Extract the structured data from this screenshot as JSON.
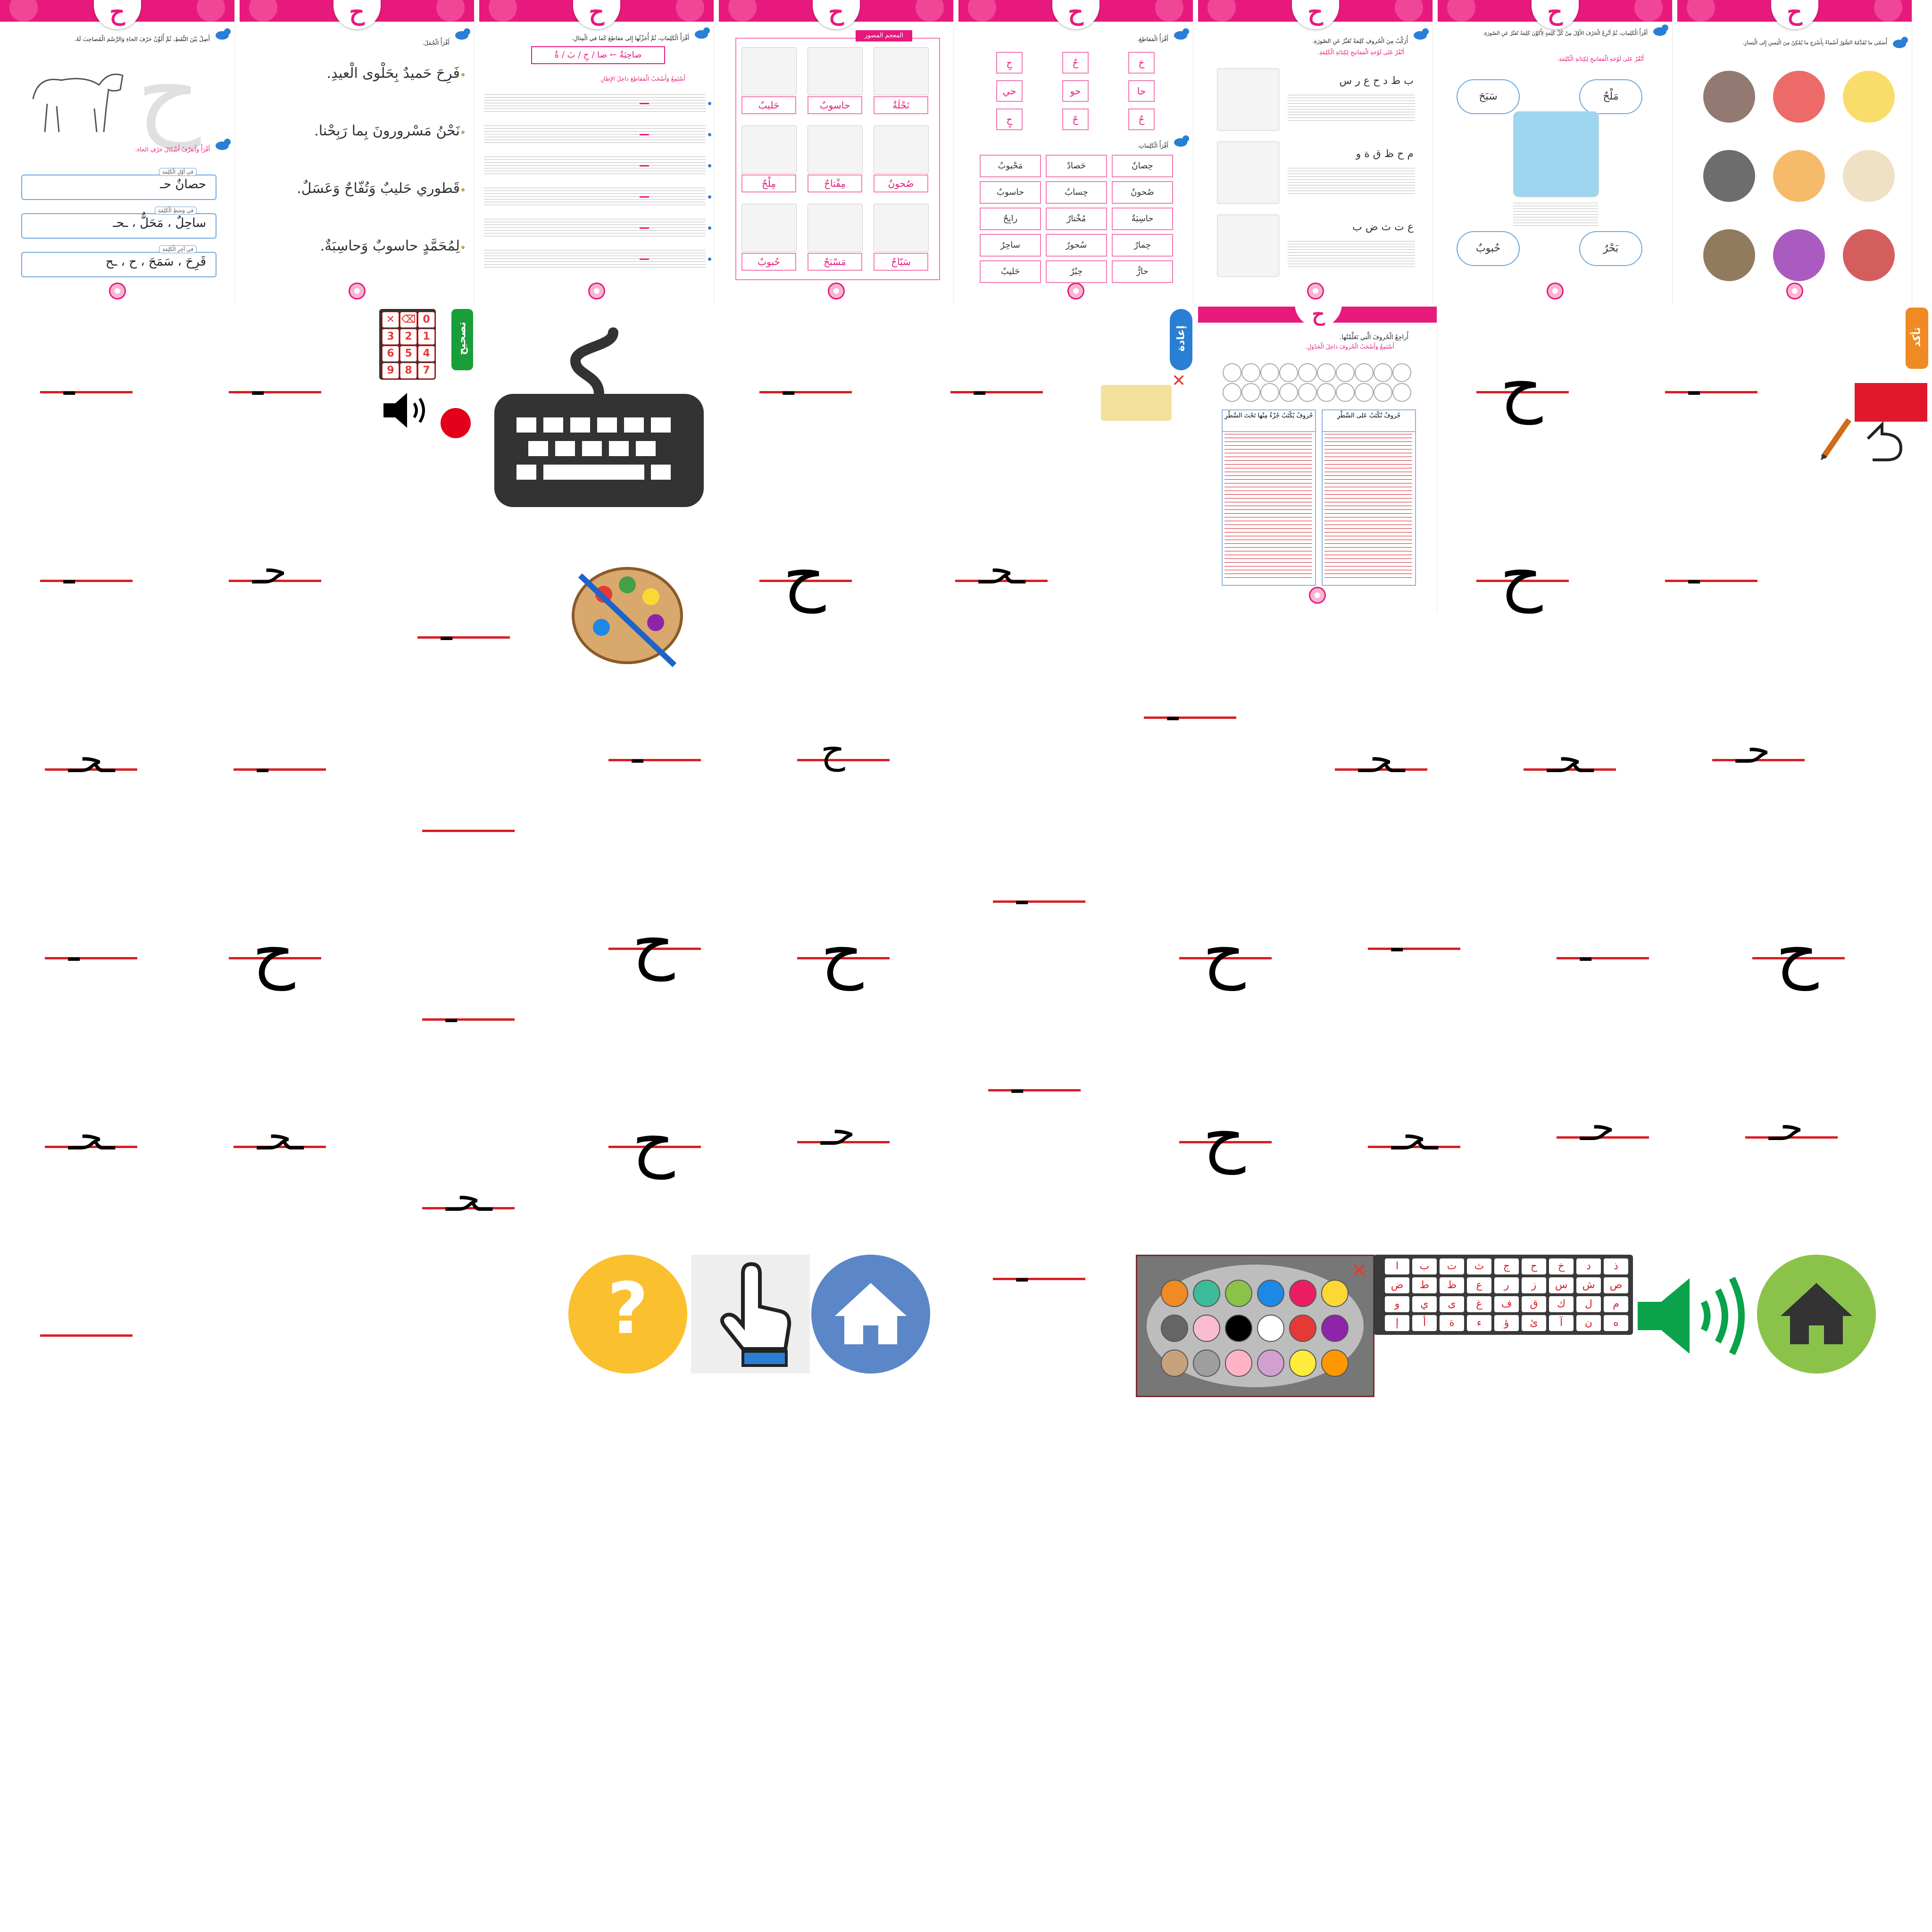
{
  "page_letter": "ح",
  "pages": [
    {
      "title": "ح",
      "inst1": "أَصِلُ بَيْنَ النُّقَطِ، ثُمَّ أُلَوِّنُ حَرْفَ الحاءِ وَالرَّسْمَ الْمُصاحِبَ لَهُ.",
      "inst2": "أَقْرَأُ وَأَتَعَرَّفُ أَشْكالَ حَرْفِ الحاءِ.",
      "rows": [
        {
          "label": "في أوَّلِ الْكَلِمَةِ",
          "text": "حصانٌ    حـ"
        },
        {
          "label": "في وَسَطِ الْكَلِمَةِ",
          "text": "ساحِلٌ ، مَحَلٌّ ، ـحـ"
        },
        {
          "label": "في آخِرِ الْكَلِمَةِ",
          "text": "قَرِحَ ، سَمَحَ ، ح ، ـح"
        }
      ]
    },
    {
      "title": "ح",
      "inst": "أَقْرَأُ الْجُمَلَ.",
      "sentences": [
        "فَرِحَ حَميدٌ بِحَلْوى الْعيدِ.",
        "نَحْنُ مَسْرورونَ بِما رَبِحْنا.",
        "قَطوري حَليبٌ وَتُفّاحٌ وَعَسَلٌ.",
        "لِمُحَمَّدٍ حاسوبٌ وَحاسِبَةٌ."
      ]
    },
    {
      "title": "ح",
      "inst": "أَقْرَأُ الْكَلِماتِ، ثُمَّ أُجَزِّئُها إِلى مَقاطِعَ كَما في الْمِثالِ.",
      "example": "صاحِبَةٌ ← صا / حِ / بَ / ةٌ",
      "sub": "أَسْتَمِعُ وَأَسْحَبُ الْمَقاطِعَ داخِلَ الإِطارِ."
    },
    {
      "title": "ح",
      "header": "المعجم المصور",
      "words": [
        "نَحْلَةٌ",
        "حاسوبٌ",
        "حَليبٌ",
        "صُحونٌ",
        "مِفْتاحٌ",
        "مِلْحٌ",
        "سَبّاحٌ",
        "مَسْبَحٌ",
        "حُبوبٌ"
      ]
    },
    {
      "title": "ح",
      "inst1": "أَقْرَأُ الْمَقاطِعَ.",
      "syllables": [
        "حَ",
        "حُ",
        "حِ",
        "حا",
        "حو",
        "حي",
        "حٌ",
        "حً",
        "حٍ"
      ],
      "inst2": "أَقْرَأُ الْكَلِماتِ.",
      "words": [
        "حِصانٌ",
        "حَصادٌ",
        "مَحْبوبٌ",
        "صُحونٌ",
        "حِسابٌ",
        "حاسوبٌ",
        "حاسِبَةٌ",
        "مُخْتارٌ",
        "رابِحٌ",
        "حِمارٌ",
        "سُحورٌ",
        "ساحِرٌ",
        "حارٌّ",
        "حِبْرٌ",
        "حَليبٌ"
      ]
    },
    {
      "title": "ح",
      "inst": "أُرَكِّبُ مِنَ الْحُروفِ كَلِمَةً تُعَبِّرُ عَنِ الصّورَةِ.",
      "sub": "أَنْقُرُ عَلى لَوْحَةِ الْمَفاتيحِ لِكِتابَةِ الْكَلِمَةِ.",
      "rows": [
        "ب ط د ح ع ر س",
        "م ح ظ ق ة و",
        "ع ت ث ض ب"
      ]
    },
    {
      "title": "ح",
      "inst": "أَقْرَأُ الْكَلِماتِ، ثُمَّ أَنْزِعُ الْحَرْفَ الأَوَّلَ مِنْ كُلِّ كَلِمَةٍ لِأُكَوِّنَ كَلِمَةً تُعَبِّرُ عَنِ الصّورَةِ.",
      "sub": "أَنْقُرُ عَلى لَوْحَةِ الْمَفاتيحِ لِكِتابَةِ الْكَلِمَةِ.",
      "clouds": [
        "مَلْحٌ",
        "سَبَحَ",
        "بَحْرٌ",
        "حُبوبٌ"
      ]
    },
    {
      "title": "ح",
      "inst": "أُسَمّي ما تُقَدِّمُهُ الصُّوَرُ أَسْماءً بِأَسْرَعِ ما يُمْكِنُ مِنَ الْيَمينِ إِلى الْيَسارِ."
    }
  ],
  "controls": {
    "correct_label": "تصحيح",
    "retry_label": "إعادة",
    "confirm_label": "تأكد",
    "keypad_keys": [
      "0",
      "⌫",
      "✕",
      "1",
      "2",
      "3",
      "4",
      "5",
      "6",
      "7",
      "8",
      "9"
    ],
    "review_inst": "أُراجِعُ الْحُروفَ الَّتي تَعَلَّمْتُها.",
    "review_sub": "أَسْتَمِعُ وَأَسْحَبُ الْحُروفَ داخِلَ الْجَدْوَلِ.",
    "col_right": "حُروفٌ تُكْتَبُ عَلى السَّطْرِ",
    "col_left": "حُروفٌ يُكْتَبُ جُزْءٌ مِنْها تَحْتَ السَّطْرِ",
    "arabic_keys": [
      "ذ",
      "د",
      "خ",
      "ح",
      "ج",
      "ث",
      "ت",
      "ب",
      "ا",
      "ص",
      "ش",
      "س",
      "ز",
      "ر",
      "ع",
      "ظ",
      "ط",
      "ض",
      "م",
      "ل",
      "ك",
      "ق",
      "ف",
      "غ",
      "ى",
      "ي",
      "و",
      "ه",
      "ن",
      "آ",
      "ئ",
      "ؤ",
      "ء",
      "ة",
      "أ",
      "إ"
    ]
  },
  "glyphs": [
    {
      "g": "ـ",
      "big": false
    },
    {
      "g": "ـ",
      "big": false
    },
    {
      "g": "ـ",
      "big": false
    },
    {
      "g": "ـ",
      "big": false
    },
    {
      "g": "ح",
      "big": true
    },
    {
      "g": "ـ",
      "big": false
    },
    {
      "g": "ـ",
      "big": false
    },
    {
      "g": "حـ",
      "big": false
    },
    {
      "g": "ـ",
      "big": false
    },
    {
      "g": "ح",
      "big": true
    },
    {
      "g": "ـحـ",
      "big": false
    },
    {
      "g": "ح",
      "big": true
    },
    {
      "g": "ـ",
      "big": false
    },
    {
      "g": "ـ",
      "big": false
    },
    {
      "g": "ـحـ",
      "big": false
    },
    {
      "g": "ـ",
      "big": false
    },
    {
      "g": "ـ",
      "big": false
    },
    {
      "g": "ح",
      "big": false
    },
    {
      "g": "ـحـ",
      "big": false
    },
    {
      "g": "ـحـ",
      "big": false
    },
    {
      "g": "حـ",
      "big": false
    },
    {
      "g": "",
      "big": false
    },
    {
      "g": "ـ",
      "big": false
    },
    {
      "g": "ـ",
      "big": false
    },
    {
      "g": "ح",
      "big": true
    },
    {
      "g": "ـ",
      "big": false
    },
    {
      "g": "ح",
      "big": true
    },
    {
      "g": "ح",
      "big": true
    },
    {
      "g": "ـ",
      "big": false
    },
    {
      "g": "ح",
      "big": true
    },
    {
      "g": "ـ",
      "big": false
    },
    {
      "g": "ـ",
      "big": false
    },
    {
      "g": "ح",
      "big": true
    },
    {
      "g": "ـحـ",
      "big": false
    },
    {
      "g": "ـحـ",
      "big": false
    },
    {
      "g": "ح",
      "big": true
    },
    {
      "g": "حـ",
      "big": false
    },
    {
      "g": "ح",
      "big": true
    },
    {
      "g": "ـحـ",
      "big": false
    },
    {
      "g": "حـ",
      "big": false
    },
    {
      "g": "حـ",
      "big": false
    },
    {
      "g": "ـحـ",
      "big": false
    },
    {
      "g": "ـ",
      "big": false
    },
    {
      "g": "",
      "big": false
    }
  ],
  "colors": {
    "pink": "#e8197d",
    "red_line": "#d81f26",
    "blue": "#2a7fd4",
    "green": "#1a9e3a",
    "orange": "#f08a24",
    "yellow": "#fbc02d",
    "home_blue": "#5b86c8",
    "home_green": "#8bc34a"
  }
}
